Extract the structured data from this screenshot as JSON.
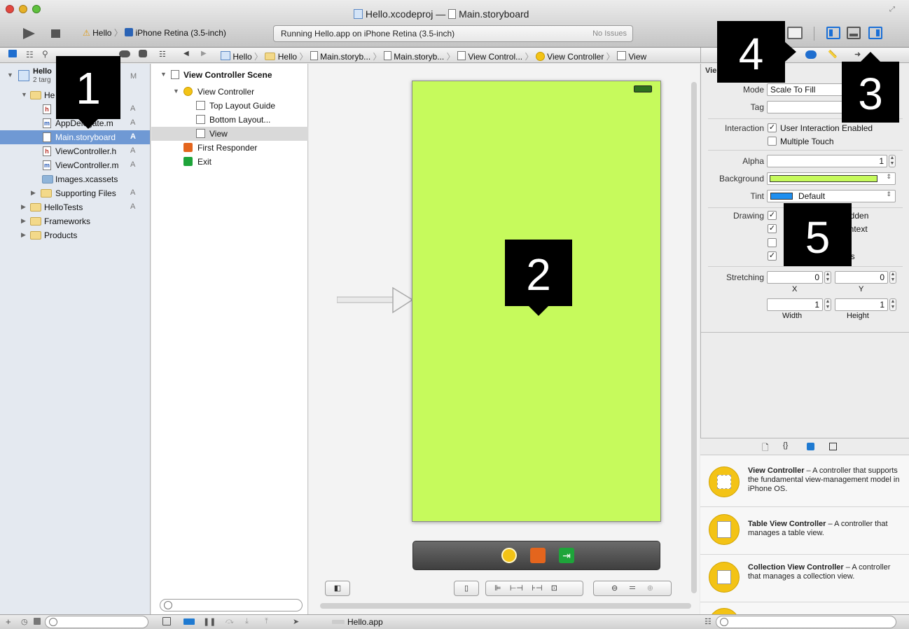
{
  "window": {
    "project_title": "Hello.xcodeproj",
    "separator": "—",
    "file_title": "Main.storyboard"
  },
  "toolbar": {
    "scheme_target": "Hello",
    "scheme_device": "iPhone Retina (3.5-inch)",
    "activity_text": "Running Hello.app on iPhone Retina (3.5-inch)",
    "issues_text": "No Issues"
  },
  "jumpbar": {
    "crumbs": [
      "Hello",
      "Hello",
      "Main.storyb...",
      "Main.storyb...",
      "View Control...",
      "View Controller",
      "View"
    ]
  },
  "navigator": {
    "project_name": "Hello",
    "project_subtitle": "2 targ",
    "project_status": "M",
    "group_name": "He",
    "items": [
      {
        "label": "",
        "icon": "h",
        "status": "A"
      },
      {
        "label": "AppDelegate.m",
        "icon": "m",
        "status": "A"
      },
      {
        "label": "Main.storyboard",
        "icon": "storyboard",
        "status": "A"
      },
      {
        "label": "ViewController.h",
        "icon": "h",
        "status": "A"
      },
      {
        "label": "ViewController.m",
        "icon": "m",
        "status": "A"
      },
      {
        "label": "Images.xcassets",
        "icon": "assets",
        "status": ""
      },
      {
        "label": "Supporting Files",
        "icon": "folder",
        "status": "A"
      },
      {
        "label": "HelloTests",
        "icon": "folder",
        "status": "A"
      },
      {
        "label": "Frameworks",
        "icon": "folder",
        "status": ""
      },
      {
        "label": "Products",
        "icon": "folder",
        "status": ""
      }
    ]
  },
  "outline": {
    "scene": "View Controller Scene",
    "controller": "View Controller",
    "top_guide": "Top Layout Guide",
    "bottom_guide": "Bottom Layout...",
    "view": "View",
    "first_responder": "First Responder",
    "exit": "Exit"
  },
  "inspector": {
    "section_title": "Vie",
    "mode_label": "Mode",
    "mode_value": "Scale To Fill",
    "tag_label": "Tag",
    "interaction_label": "Interaction",
    "user_interaction": "User Interaction Enabled",
    "multiple_touch": "Multiple Touch",
    "alpha_label": "Alpha",
    "alpha_value": "1",
    "background_label": "Background",
    "background_color": "#c6fa5c",
    "tint_label": "Tint",
    "tint_value": "Default",
    "tint_color": "#1e8ff0",
    "drawing_label": "Drawing",
    "drawing_opts": [
      "idden",
      "ontext",
      "",
      "ws"
    ],
    "stretching_label": "Stretching",
    "stretch_x": "0",
    "stretch_y": "0",
    "stretch_w": "1",
    "stretch_h": "1",
    "x_label": "X",
    "y_label": "Y",
    "width_label": "Width",
    "height_label": "Height"
  },
  "library": {
    "items": [
      {
        "title": "View Controller",
        "desc": " – A controller that supports the fundamental view-management model in iPhone OS."
      },
      {
        "title": "Table View Controller",
        "desc": " – A controller that manages a table view."
      },
      {
        "title": "Collection View Controller",
        "desc": " – A controller that manages a collection view."
      }
    ]
  },
  "statusbar": {
    "app_name": "Hello.app"
  },
  "canvas": {
    "device_color": "#c6fa5c"
  },
  "badges": {
    "b1": "1",
    "b2": "2",
    "b3": "3",
    "b4": "4",
    "b5": "5"
  }
}
